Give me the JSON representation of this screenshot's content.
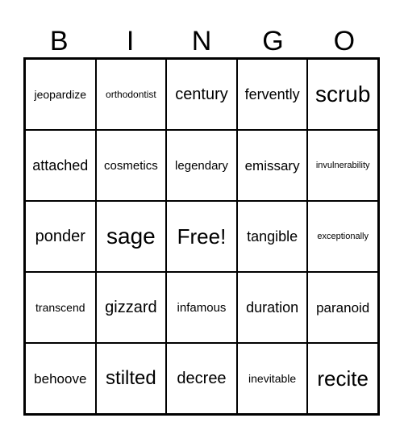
{
  "header": {
    "letters": [
      "B",
      "I",
      "N",
      "G",
      "O"
    ]
  },
  "card": {
    "rows": [
      [
        "jeopardize",
        "orthodontist",
        "century",
        "fervently",
        "scrub"
      ],
      [
        "attached",
        "cosmetics",
        "legendary",
        "emissary",
        "invulnerability"
      ],
      [
        "ponder",
        "sage",
        "Free!",
        "tangible",
        "exceptionally"
      ],
      [
        "transcend",
        "gizzard",
        "infamous",
        "duration",
        "paranoid"
      ],
      [
        "behoove",
        "stilted",
        "decree",
        "inevitable",
        "recite"
      ]
    ]
  }
}
